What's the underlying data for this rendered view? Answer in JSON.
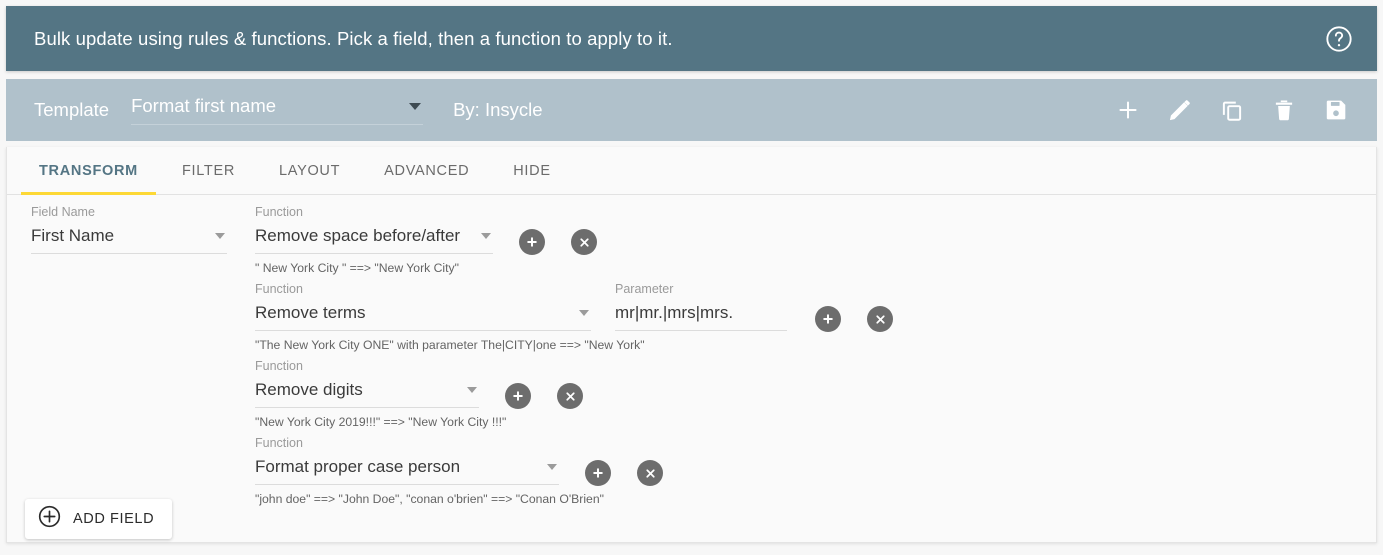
{
  "banner": {
    "text": "Bulk update using rules & functions. Pick a field, then a function to apply to it.",
    "help_icon": "help-circle-icon",
    "background_color": "#547584"
  },
  "template_bar": {
    "label": "Template",
    "selected_template": "Format first name",
    "author": "By: Insycle",
    "background_color": "#b0c1cb",
    "actions": [
      {
        "name": "add",
        "icon": "plus-icon"
      },
      {
        "name": "edit",
        "icon": "pencil-icon"
      },
      {
        "name": "duplicate",
        "icon": "copy-icon"
      },
      {
        "name": "delete",
        "icon": "trash-icon"
      },
      {
        "name": "save",
        "icon": "save-disk-icon"
      }
    ]
  },
  "tabs": {
    "active_index": 0,
    "active_color": "#547584",
    "underline_color": "#fdd835",
    "items": [
      {
        "label": "TRANSFORM"
      },
      {
        "label": "FILTER"
      },
      {
        "label": "LAYOUT"
      },
      {
        "label": "ADVANCED"
      },
      {
        "label": "HIDE"
      }
    ]
  },
  "transform": {
    "field_name_label": "Field Name",
    "function_label": "Function",
    "parameter_label": "Parameter",
    "field_name_value": "First Name",
    "rows": [
      {
        "function": "Remove space before/after",
        "hint": "\" New York City \" ==> \"New York City\""
      },
      {
        "function": "Remove terms",
        "parameter_value": "mr|mr.|mrs|mrs.",
        "hint": "\"The New York City ONE\" with parameter The|CITY|one ==> \"New York\""
      },
      {
        "function": "Remove digits",
        "hint": "\"New York City 2019!!!\" ==> \"New York City !!!\""
      },
      {
        "function": "Format proper case person",
        "hint": "\"john doe\" ==> \"John Doe\", \"conan o'brien\" ==> \"Conan O'Brien\""
      }
    ]
  },
  "add_field_button": {
    "label": "ADD FIELD",
    "icon": "circle-plus-icon"
  }
}
